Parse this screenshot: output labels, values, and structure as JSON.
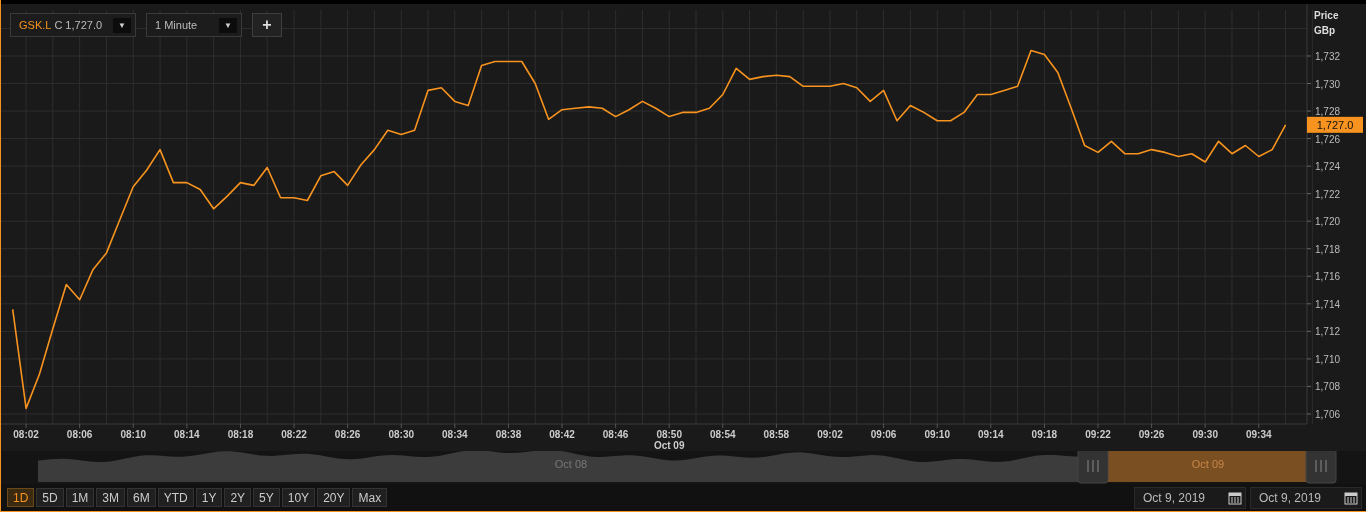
{
  "toolbar": {
    "symbol": {
      "close_label": "C",
      "price": "1,727.0",
      "caret": "▼"
    },
    "interval": {
      "label": "1 Minute",
      "caret": "▼"
    },
    "add_button": "+"
  },
  "chart": {
    "axis_title": "Price",
    "axis_unit": "GBp",
    "last_price": "1,727.0",
    "date_label": "Oct 09",
    "chart_data": {
      "type": "line",
      "grid": true,
      "ylim": [
        1705.27,
        1735.34
      ],
      "categories": [
        null,
        "08:02",
        null,
        null,
        null,
        "08:06",
        null,
        null,
        null,
        "08:10",
        null,
        null,
        null,
        "08:14",
        null,
        null,
        null,
        "08:18",
        null,
        null,
        null,
        "08:22",
        null,
        null,
        null,
        "08:26",
        null,
        null,
        null,
        "08:30",
        null,
        null,
        null,
        "08:34",
        null,
        null,
        null,
        "08:38",
        null,
        null,
        null,
        "08:42",
        null,
        null,
        null,
        "08:46",
        null,
        null,
        null,
        "08:50",
        null,
        null,
        null,
        "08:54",
        null,
        null,
        null,
        "08:58",
        null,
        null,
        null,
        "09:02",
        null,
        null,
        null,
        "09:06",
        null,
        null,
        null,
        "09:10",
        null,
        null,
        null,
        "09:14",
        null,
        null,
        null,
        "09:18",
        null,
        null,
        null,
        "09:22",
        null,
        null,
        null,
        "09:26",
        null,
        null,
        null,
        "09:30",
        null,
        null,
        null,
        "09:34",
        null,
        null
      ],
      "series": [
        {
          "name": "GSK.L",
          "color": "#f7931e",
          "values": [
            1713.6,
            1706.4,
            1708.9,
            1712.2,
            1715.4,
            1714.3,
            1716.5,
            1717.7,
            1720.1,
            1722.5,
            1723.7,
            1725.2,
            1722.8,
            1722.8,
            1722.3,
            1720.9,
            1721.8,
            1722.8,
            1722.6,
            1723.9,
            1721.7,
            1721.7,
            1721.5,
            1723.3,
            1723.6,
            1722.6,
            1724.1,
            1725.2,
            1726.6,
            1726.3,
            1726.6,
            1729.5,
            1729.7,
            1728.7,
            1728.4,
            1731.3,
            1731.6,
            1731.6,
            1731.6,
            1730.0,
            1727.4,
            1728.1,
            1728.2,
            1728.3,
            1728.2,
            1727.6,
            1728.1,
            1728.7,
            1728.2,
            1727.6,
            1727.9,
            1727.9,
            1728.2,
            1729.2,
            1731.1,
            1730.3,
            1730.5,
            1730.6,
            1730.5,
            1729.8,
            1729.8,
            1729.8,
            1730.0,
            1729.7,
            1728.7,
            1729.5,
            1727.3,
            1728.4,
            1727.9,
            1727.3,
            1727.3,
            1727.9,
            1729.2,
            1729.2,
            1729.5,
            1729.8,
            1732.4,
            1732.1,
            1730.8,
            1728.2,
            1725.5,
            1725.0,
            1725.8,
            1724.9,
            1724.9,
            1725.2,
            1725.0,
            1724.7,
            1724.9,
            1724.3,
            1725.8,
            1724.9,
            1725.5,
            1724.7,
            1725.2,
            1727.0
          ]
        }
      ],
      "yticks": [
        {
          "value": 1706,
          "label": "1,706"
        },
        {
          "value": 1708,
          "label": "1,708"
        },
        {
          "value": 1710,
          "label": "1,710"
        },
        {
          "value": 1712,
          "label": "1,712"
        },
        {
          "value": 1714,
          "label": "1,714"
        },
        {
          "value": 1716,
          "label": "1,716"
        },
        {
          "value": 1718,
          "label": "1,718"
        },
        {
          "value": 1720,
          "label": "1,720"
        },
        {
          "value": 1722,
          "label": "1,722"
        },
        {
          "value": 1724,
          "label": "1,724"
        },
        {
          "value": 1726,
          "label": "1,726"
        },
        {
          "value": 1728,
          "label": "1,728"
        },
        {
          "value": 1730,
          "label": "1,730"
        },
        {
          "value": 1732,
          "label": "1,732"
        }
      ]
    }
  },
  "navigator": {
    "labels": [
      "Oct 08",
      "Oct 09"
    ]
  },
  "ranges": [
    {
      "label": "1D",
      "selected": true
    },
    {
      "label": "5D",
      "selected": false
    },
    {
      "label": "1M",
      "selected": false
    },
    {
      "label": "3M",
      "selected": false
    },
    {
      "label": "6M",
      "selected": false
    },
    {
      "label": "YTD",
      "selected": false
    },
    {
      "label": "1Y",
      "selected": false
    },
    {
      "label": "2Y",
      "selected": false
    },
    {
      "label": "5Y",
      "selected": false
    },
    {
      "label": "10Y",
      "selected": false
    },
    {
      "label": "20Y",
      "selected": false
    },
    {
      "label": "Max",
      "selected": false
    }
  ],
  "date_range": {
    "from": "Oct 9, 2019",
    "to": "Oct 9, 2019"
  }
}
